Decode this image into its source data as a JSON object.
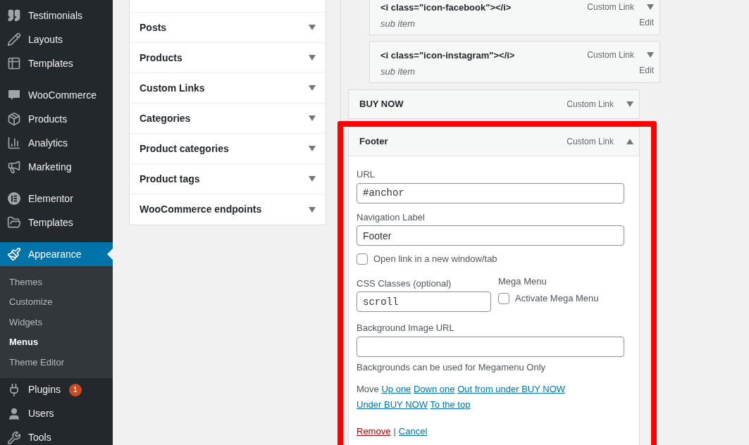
{
  "sidebar": {
    "groups": [
      [
        {
          "label": "Testimonials",
          "selected": false
        },
        {
          "label": "Layouts",
          "selected": false
        },
        {
          "label": "Templates",
          "selected": false
        }
      ],
      [
        {
          "label": "WooCommerce",
          "selected": false
        },
        {
          "label": "Products",
          "selected": false
        },
        {
          "label": "Analytics",
          "selected": false
        },
        {
          "label": "Marketing",
          "selected": false
        }
      ],
      [
        {
          "label": "Elementor",
          "selected": false
        },
        {
          "label": "Templates",
          "selected": false
        }
      ],
      [
        {
          "label": "Appearance",
          "selected": true,
          "children": [
            {
              "label": "Themes",
              "selected": false
            },
            {
              "label": "Customize",
              "selected": false
            },
            {
              "label": "Widgets",
              "selected": false
            },
            {
              "label": "Menus",
              "selected": true
            },
            {
              "label": "Theme Editor",
              "selected": false
            }
          ]
        },
        {
          "label": "Plugins",
          "selected": false,
          "badge": "1"
        },
        {
          "label": "Users",
          "selected": false
        },
        {
          "label": "Tools",
          "selected": false
        }
      ]
    ]
  },
  "add_items": [
    {
      "label": "Posts",
      "expanded": false
    },
    {
      "label": "Products",
      "expanded": false
    },
    {
      "label": "Custom Links",
      "expanded": false
    },
    {
      "label": "Categories",
      "expanded": false
    },
    {
      "label": "Product categories",
      "expanded": false
    },
    {
      "label": "Product tags",
      "expanded": false
    },
    {
      "label": "WooCommerce endpoints",
      "expanded": false
    }
  ],
  "menu_items": [
    {
      "children": [
        {
          "title": "<i class=\"icon-facebook\"></i>",
          "subtitle": "sub item",
          "type": "Custom Link",
          "expanded": false,
          "edit": "Edit"
        },
        {
          "title": "<i class=\"icon-instagram\"></i>",
          "subtitle": "sub item",
          "type": "Custom Link",
          "expanded": false,
          "edit": "Edit"
        }
      ]
    },
    {
      "title": "BUY NOW",
      "type": "Custom Link",
      "expanded": false
    },
    {
      "title": "Footer",
      "type": "Custom Link",
      "expanded": true,
      "highlighted": true,
      "settings": {
        "url": {
          "label": "URL",
          "value": "#anchor"
        },
        "nav_label": {
          "label": "Navigation Label",
          "value": "Footer"
        },
        "new_window": {
          "label": "Open link in a new window/tab",
          "checked": false
        },
        "css_classes": {
          "label": "CSS Classes (optional)",
          "value": "scroll"
        },
        "mega_menu": {
          "label": "Mega Menu",
          "checkbox_label": "Activate Mega Menu",
          "checked": false
        },
        "background_image": {
          "label": "Background Image URL"
        },
        "background_note": "Backgrounds can be used for Megamenu Only",
        "move": {
          "label": "Move",
          "links": [
            "Up one",
            "Down one",
            "Out from under BUY NOW",
            "Under BUY NOW",
            "To the top"
          ]
        },
        "remove": "Remove",
        "separator": "|",
        "cancel": "Cancel"
      }
    }
  ]
}
